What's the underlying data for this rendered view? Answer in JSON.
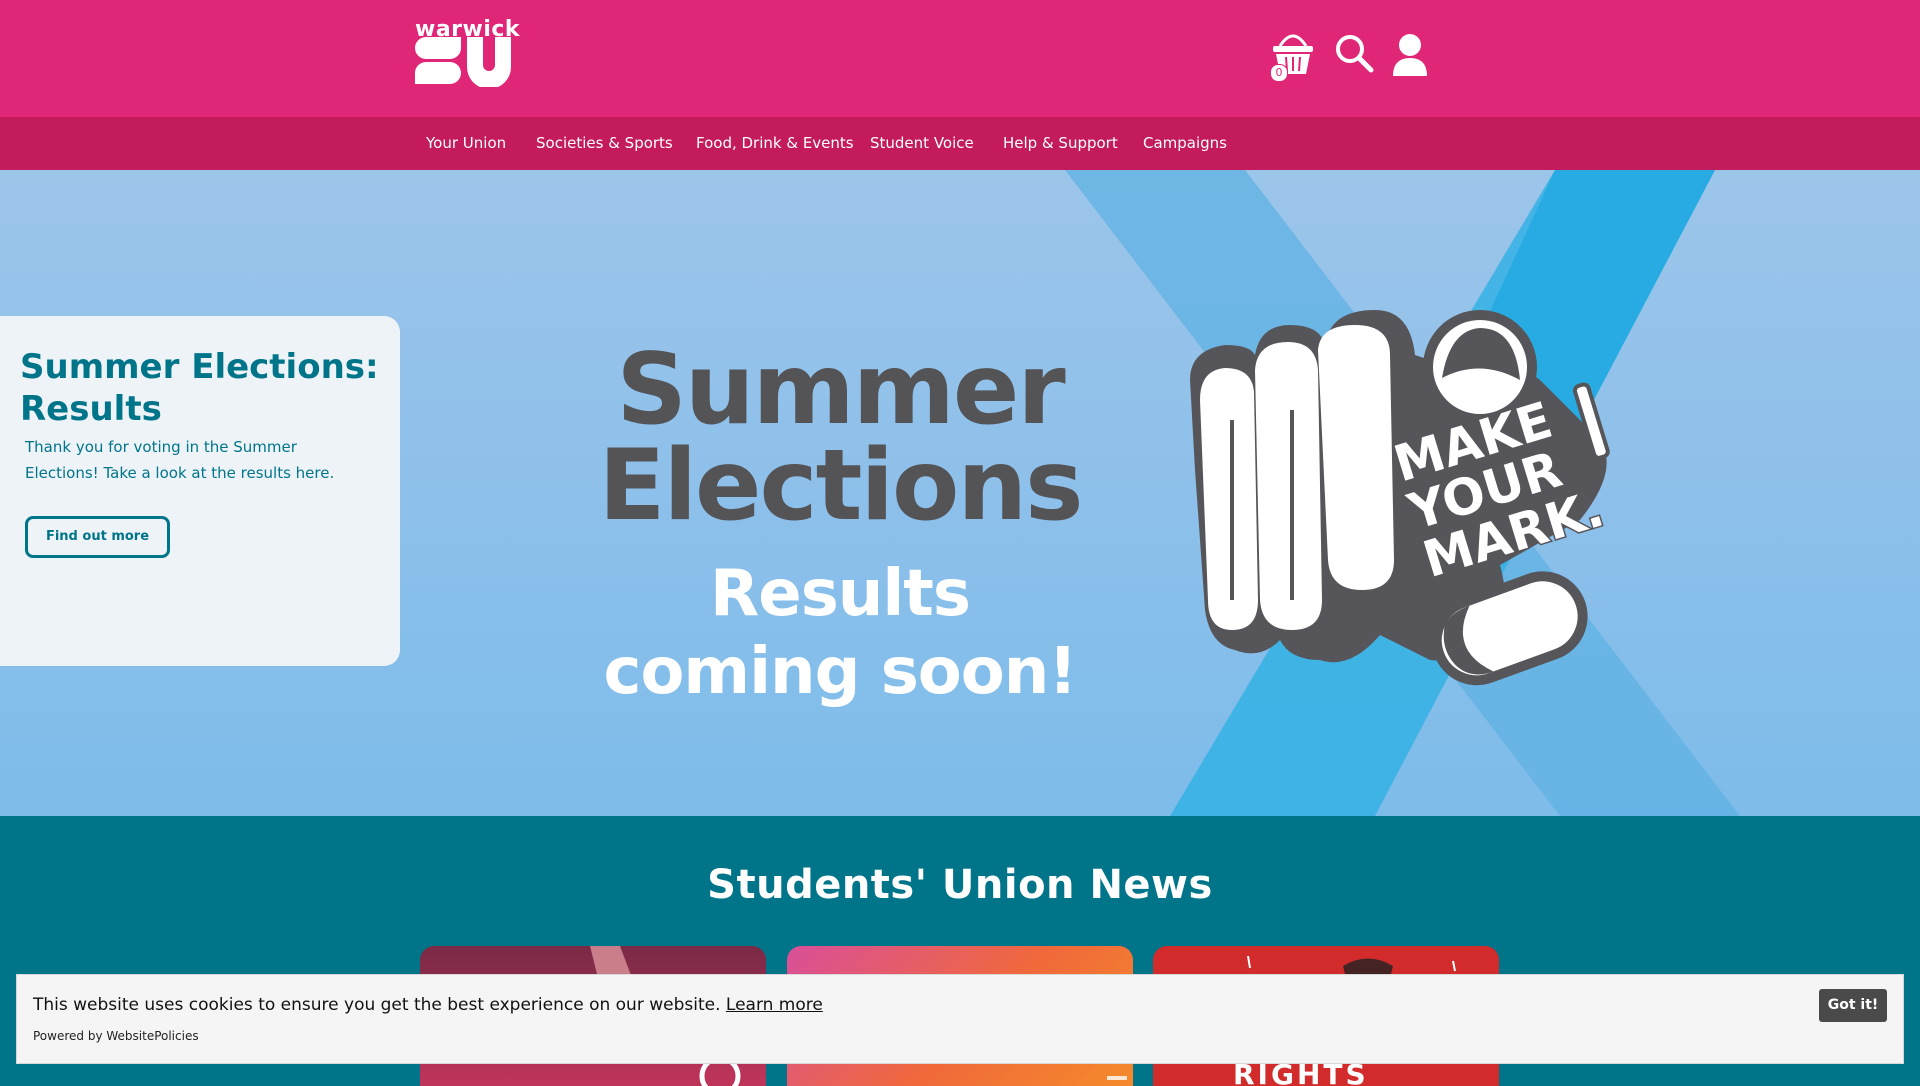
{
  "header": {
    "logo_wordmark": "warwick",
    "logo_letters": "SU",
    "basket_count": "0",
    "icons": [
      "basket-icon",
      "search-icon",
      "user-icon"
    ]
  },
  "nav": {
    "items": [
      {
        "label": "Your Union"
      },
      {
        "label": "Societies & Sports"
      },
      {
        "label": "Food, Drink & Events"
      },
      {
        "label": "Student Voice"
      },
      {
        "label": "Help & Support"
      },
      {
        "label": "Campaigns"
      }
    ]
  },
  "hero": {
    "title_line1": "Summer",
    "title_line2": "Elections",
    "sub_line1": "Results",
    "sub_line2": "coming soon!",
    "badge_line1": "MAKE",
    "badge_line2": "YOUR",
    "badge_line3": "MARK."
  },
  "promo_card": {
    "title": "Summer Elections: Results",
    "text": "Thank you for voting in the Summer Elections! Take a look at the results here.",
    "button": "Find out more"
  },
  "news": {
    "title": "Students' Union News",
    "card3_text": "RIGHTS"
  },
  "cookie": {
    "message": "This website uses cookies to ensure you get the best experience on our website.",
    "link": "Learn more",
    "powered": "Powered by WebsitePolicies",
    "button": "Got it!"
  },
  "colors": {
    "brand_pink": "#e02677",
    "nav_pink": "#c31b5c",
    "teal": "#00758a",
    "hero_blue": "#8dc0ea"
  }
}
